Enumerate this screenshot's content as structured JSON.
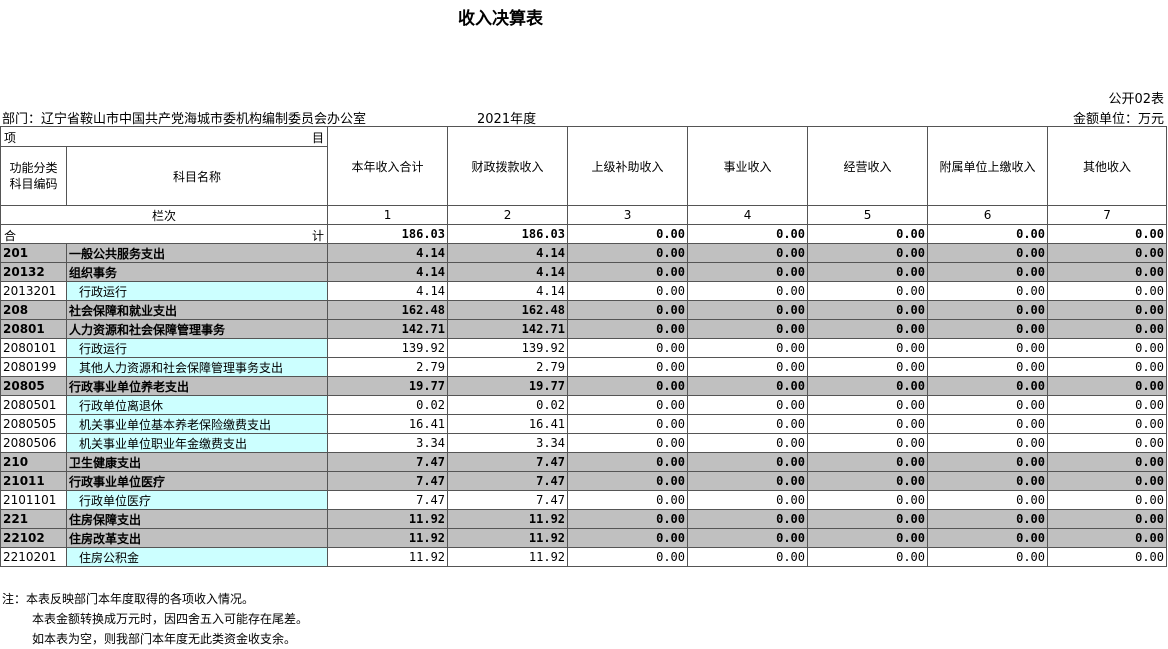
{
  "title": "收入决算表",
  "form_code": "公开02表",
  "department": "部门：辽宁省鞍山市中国共产党海城市委机构编制委员会办公室",
  "year": "2021年度",
  "unit": "金额单位：万元",
  "header": {
    "item_left": "项",
    "item_right": "目",
    "code_col": "功能分类\n科目编码",
    "name_col": "科目名称",
    "columns": [
      "本年收入合计",
      "财政拨款收入",
      "上级补助收入",
      "事业收入",
      "经营收入",
      "附属单位上缴收入",
      "其他收入"
    ],
    "row_label": "栏次",
    "col_numbers": [
      "1",
      "2",
      "3",
      "4",
      "5",
      "6",
      "7"
    ]
  },
  "total": {
    "left": "合",
    "right": "计",
    "values": [
      "186.03",
      "186.03",
      "0.00",
      "0.00",
      "0.00",
      "0.00",
      "0.00"
    ]
  },
  "rows": [
    {
      "code": "201",
      "name": "一般公共服务支出",
      "level": "grey",
      "values": [
        "4.14",
        "4.14",
        "0.00",
        "0.00",
        "0.00",
        "0.00",
        "0.00"
      ]
    },
    {
      "code": "20132",
      "name": "组织事务",
      "level": "grey",
      "values": [
        "4.14",
        "4.14",
        "0.00",
        "0.00",
        "0.00",
        "0.00",
        "0.00"
      ]
    },
    {
      "code": "2013201",
      "name": "行政运行",
      "level": "cyan",
      "values": [
        "4.14",
        "4.14",
        "0.00",
        "0.00",
        "0.00",
        "0.00",
        "0.00"
      ]
    },
    {
      "code": "208",
      "name": "社会保障和就业支出",
      "level": "grey",
      "values": [
        "162.48",
        "162.48",
        "0.00",
        "0.00",
        "0.00",
        "0.00",
        "0.00"
      ]
    },
    {
      "code": "20801",
      "name": "人力资源和社会保障管理事务",
      "level": "grey",
      "values": [
        "142.71",
        "142.71",
        "0.00",
        "0.00",
        "0.00",
        "0.00",
        "0.00"
      ]
    },
    {
      "code": "2080101",
      "name": "行政运行",
      "level": "cyan",
      "values": [
        "139.92",
        "139.92",
        "0.00",
        "0.00",
        "0.00",
        "0.00",
        "0.00"
      ]
    },
    {
      "code": "2080199",
      "name": "其他人力资源和社会保障管理事务支出",
      "level": "cyan",
      "values": [
        "2.79",
        "2.79",
        "0.00",
        "0.00",
        "0.00",
        "0.00",
        "0.00"
      ]
    },
    {
      "code": "20805",
      "name": "行政事业单位养老支出",
      "level": "grey",
      "values": [
        "19.77",
        "19.77",
        "0.00",
        "0.00",
        "0.00",
        "0.00",
        "0.00"
      ]
    },
    {
      "code": "2080501",
      "name": "行政单位离退休",
      "level": "cyan",
      "values": [
        "0.02",
        "0.02",
        "0.00",
        "0.00",
        "0.00",
        "0.00",
        "0.00"
      ]
    },
    {
      "code": "2080505",
      "name": "机关事业单位基本养老保险缴费支出",
      "level": "cyan",
      "values": [
        "16.41",
        "16.41",
        "0.00",
        "0.00",
        "0.00",
        "0.00",
        "0.00"
      ]
    },
    {
      "code": "2080506",
      "name": "机关事业单位职业年金缴费支出",
      "level": "cyan",
      "values": [
        "3.34",
        "3.34",
        "0.00",
        "0.00",
        "0.00",
        "0.00",
        "0.00"
      ]
    },
    {
      "code": "210",
      "name": "卫生健康支出",
      "level": "grey",
      "values": [
        "7.47",
        "7.47",
        "0.00",
        "0.00",
        "0.00",
        "0.00",
        "0.00"
      ]
    },
    {
      "code": "21011",
      "name": "行政事业单位医疗",
      "level": "grey",
      "values": [
        "7.47",
        "7.47",
        "0.00",
        "0.00",
        "0.00",
        "0.00",
        "0.00"
      ]
    },
    {
      "code": "2101101",
      "name": "行政单位医疗",
      "level": "cyan",
      "values": [
        "7.47",
        "7.47",
        "0.00",
        "0.00",
        "0.00",
        "0.00",
        "0.00"
      ]
    },
    {
      "code": "221",
      "name": "住房保障支出",
      "level": "grey",
      "values": [
        "11.92",
        "11.92",
        "0.00",
        "0.00",
        "0.00",
        "0.00",
        "0.00"
      ]
    },
    {
      "code": "22102",
      "name": "住房改革支出",
      "level": "grey",
      "values": [
        "11.92",
        "11.92",
        "0.00",
        "0.00",
        "0.00",
        "0.00",
        "0.00"
      ]
    },
    {
      "code": "2210201",
      "name": "住房公积金",
      "level": "cyan",
      "values": [
        "11.92",
        "11.92",
        "0.00",
        "0.00",
        "0.00",
        "0.00",
        "0.00"
      ]
    }
  ],
  "notes": [
    "注：本表反映部门本年度取得的各项收入情况。",
    "本表金额转换成万元时，因四舍五入可能存在尾差。",
    "如本表为空，则我部门本年度无此类资金收支余。"
  ]
}
